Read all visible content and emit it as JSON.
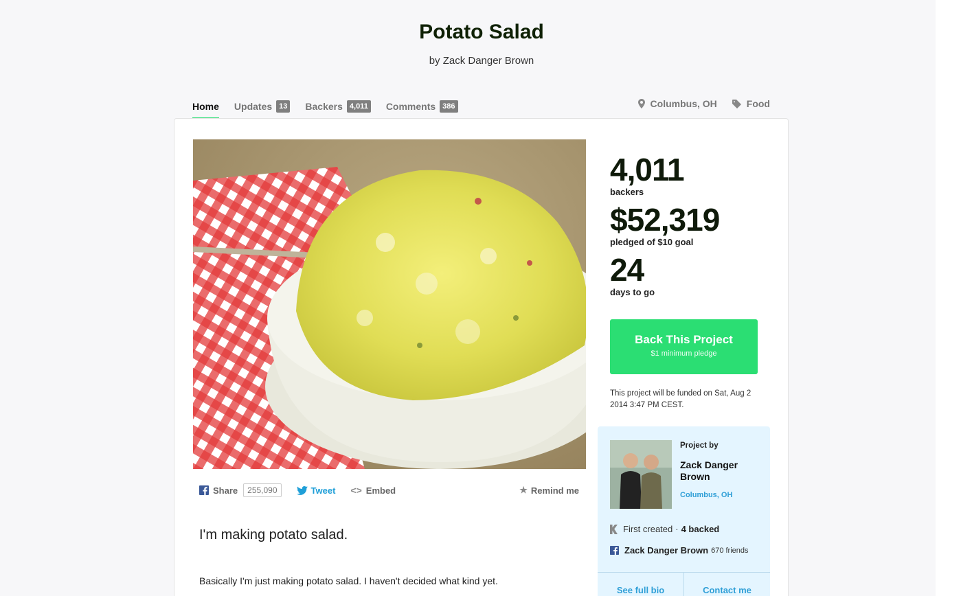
{
  "project": {
    "title": "Potato Salad",
    "byline": "by Zack Danger Brown"
  },
  "tabs": [
    {
      "label": "Home",
      "count": ""
    },
    {
      "label": "Updates",
      "count": "13"
    },
    {
      "label": "Backers",
      "count": "4,011"
    },
    {
      "label": "Comments",
      "count": "386"
    }
  ],
  "meta": {
    "location": "Columbus, OH",
    "category": "Food"
  },
  "share": {
    "share_label": "Share",
    "share_count": "255,090",
    "tweet_label": "Tweet",
    "embed_label": "Embed",
    "remind_label": "Remind me"
  },
  "description": {
    "lead": "I'm making potato salad.",
    "paragraph": "Basically I'm just making potato salad. I haven't decided what kind yet."
  },
  "stats": {
    "backers_value": "4,011",
    "backers_label": "backers",
    "pledged_value": "$52,319",
    "pledged_label": "pledged of $10 goal",
    "days_value": "24",
    "days_label": "days to go"
  },
  "cta": {
    "title": "Back This Project",
    "subtitle": "$1 minimum pledge"
  },
  "funded_note": "This project will be funded on Sat, Aug 2 2014 3:47 PM CEST.",
  "creator": {
    "project_by": "Project by",
    "name": "Zack Danger Brown",
    "location": "Columbus, OH",
    "first_created": "First created",
    "backed": "4 backed",
    "fb_name": "Zack Danger Brown",
    "friends": "670 friends",
    "see_bio": "See full bio",
    "contact": "Contact me"
  },
  "colors": {
    "accent_green": "#2bde73",
    "link_blue": "#2f9fd7",
    "creator_bg": "#e4f5ff"
  }
}
